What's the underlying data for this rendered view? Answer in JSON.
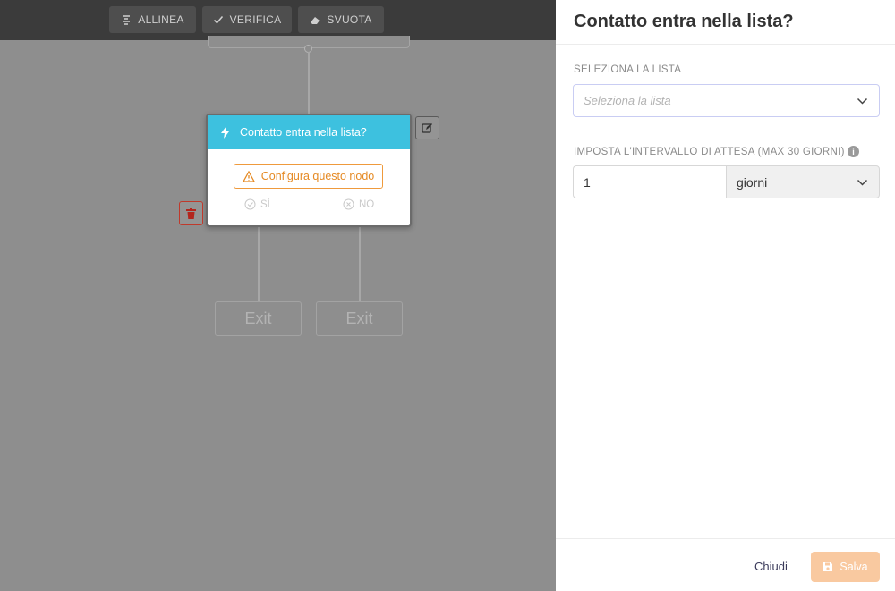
{
  "toolbar": {
    "align_label": "ALLINEA",
    "verify_label": "VERIFICA",
    "clear_label": "SVUOTA"
  },
  "node": {
    "title": "Contatto entra nella lista?",
    "config_label": "Configura questo nodo",
    "yes_label": "SÌ",
    "no_label": "NO"
  },
  "exits": [
    "Exit",
    "Exit"
  ],
  "panel": {
    "title": "Contatto entra nella lista?",
    "list_label": "SELEZIONA LA LISTA",
    "list_placeholder": "Seleziona la lista",
    "interval_label": "IMPOSTA L'INTERVALLO DI ATTESA (MAX 30 GIORNI)",
    "interval_value": "1",
    "interval_unit": "giorni",
    "close_label": "Chiudi",
    "save_label": "Salva"
  },
  "colors": {
    "node_header": "#3dc1df",
    "warning": "#e58a24",
    "save_button": "#f9c9a0",
    "delete": "#c0392b"
  },
  "icons": {
    "align": "align-center-icon",
    "verify": "check-icon",
    "clear": "eraser-icon",
    "node": "lightning-icon",
    "warning": "warning-triangle-icon",
    "yes": "check-circle-icon",
    "no": "x-circle-icon",
    "edit": "edit-icon",
    "delete": "trash-icon",
    "chevron": "chevron-down-icon",
    "info": "info-icon",
    "save": "floppy-icon"
  }
}
